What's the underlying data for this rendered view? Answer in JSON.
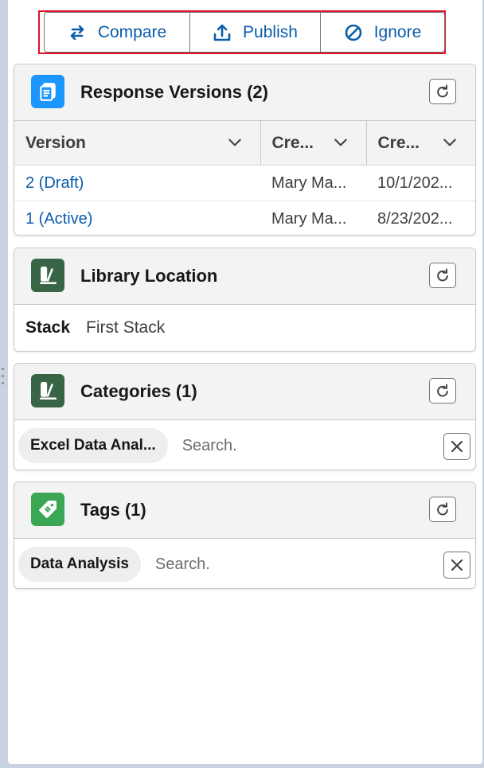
{
  "actions": {
    "compare_label": "Compare",
    "publish_label": "Publish",
    "ignore_label": "Ignore"
  },
  "response_versions": {
    "title": "Response Versions (2)",
    "columns": [
      "Version",
      "Cre...",
      "Cre..."
    ],
    "rows": [
      {
        "version": "2 (Draft)",
        "created_by": "Mary Ma...",
        "created_date": "10/1/202..."
      },
      {
        "version": "1 (Active)",
        "created_by": "Mary Ma...",
        "created_date": "8/23/202..."
      }
    ]
  },
  "library_location": {
    "title": "Library Location",
    "field_label": "Stack",
    "field_value": "First Stack"
  },
  "categories": {
    "title": "Categories (1)",
    "pill": "Excel Data Anal...",
    "search_placeholder": "Search."
  },
  "tags": {
    "title": "Tags (1)",
    "pill": "Data Analysis",
    "search_placeholder": "Search."
  },
  "colors": {
    "accent": "#0b5cab",
    "highlight": "#e0102a",
    "versions_icon_bg": "#1b96ff",
    "library_icon_bg": "#396547",
    "tags_icon_bg": "#3ba755"
  }
}
